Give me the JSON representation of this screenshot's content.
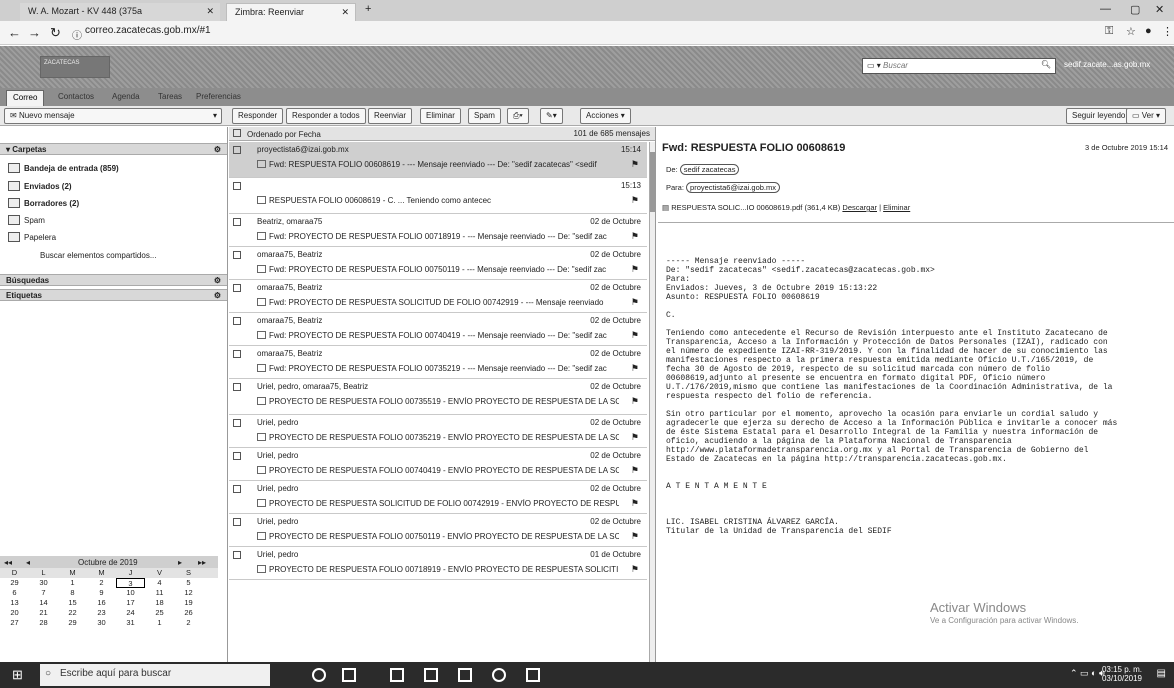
{
  "browser": {
    "tabs": [
      {
        "title": "W. A. Mozart - KV 448 (375a"
      },
      {
        "title": "Zimbra: Reenviar"
      }
    ],
    "url": "correo.zacatecas.gob.mx/#1"
  },
  "header": {
    "logo_text": "ZACATECAS",
    "search_placeholder": "Buscar",
    "user": "sedif.zacate...as.gob.mx"
  },
  "app_tabs": [
    "Correo",
    "Contactos",
    "Agenda",
    "Tareas",
    "Preferencias"
  ],
  "toolbar": {
    "new_message": "Nuevo mensaje",
    "reply": "Responder",
    "reply_all": "Responder a todos",
    "forward": "Reenviar",
    "delete": "Eliminar",
    "spam": "Spam",
    "actions": "Acciones",
    "keep_reading": "Seguir leyendo",
    "view": "Ver"
  },
  "sidebar": {
    "folders_title": "Carpetas",
    "folders": [
      {
        "label": "Bandeja de entrada (859)",
        "bold": true
      },
      {
        "label": "Enviados (2)",
        "bold": true
      },
      {
        "label": "Borradores (2)",
        "bold": true
      },
      {
        "label": "Spam",
        "bold": false
      },
      {
        "label": "Papelera",
        "bold": false
      }
    ],
    "shared": "Buscar elementos compartidos...",
    "searches_title": "Búsquedas",
    "tags_title": "Etiquetas"
  },
  "calendar": {
    "month": "Octubre de 2019",
    "weekdays": [
      "D",
      "L",
      "M",
      "M",
      "J",
      "V",
      "S"
    ],
    "weeks": [
      [
        "29",
        "30",
        "1",
        "2",
        "3",
        "4",
        "5"
      ],
      [
        "6",
        "7",
        "8",
        "9",
        "10",
        "11",
        "12"
      ],
      [
        "13",
        "14",
        "15",
        "16",
        "17",
        "18",
        "19"
      ],
      [
        "20",
        "21",
        "22",
        "23",
        "24",
        "25",
        "26"
      ],
      [
        "27",
        "28",
        "29",
        "30",
        "31",
        "1",
        "2"
      ]
    ]
  },
  "message_list": {
    "sort_label": "Ordenado por Fecha",
    "count": "101 de 685 mensajes",
    "messages": [
      {
        "from": "proyectista6@izai.gob.mx",
        "date": "15:14",
        "subject": "Fwd: RESPUESTA FOLIO 00608619 - --- Mensaje reenviado --- De: \"sedif zacatecas\" <sedif"
      },
      {
        "from": "",
        "date": "15:13",
        "subject": "RESPUESTA FOLIO 00608619 - C.  ... Teniendo como antecec"
      },
      {
        "from": "Beatriz, omaraa75",
        "date": "02 de Octubre",
        "subject": "Fwd: PROYECTO DE RESPUESTA FOLIO 00718919 - --- Mensaje reenviado --- De: \"sedif zac"
      },
      {
        "from": "omaraa75, Beatriz",
        "date": "02 de Octubre",
        "subject": "Fwd: PROYECTO DE RESPUESTA FOLIO 00750119 - --- Mensaje reenviado --- De: \"sedif zac"
      },
      {
        "from": "omaraa75, Beatriz",
        "date": "02 de Octubre",
        "subject": "Fwd: PROYECTO DE RESPUESTA SOLICITUD DE FOLIO 00742919 - --- Mensaje reenviado"
      },
      {
        "from": "omaraa75, Beatriz",
        "date": "02 de Octubre",
        "subject": "Fwd: PROYECTO DE RESPUESTA FOLIO 00740419 - --- Mensaje reenviado --- De: \"sedif zac"
      },
      {
        "from": "omaraa75, Beatriz",
        "date": "02 de Octubre",
        "subject": "Fwd: PROYECTO DE RESPUESTA FOLIO 00735219 - --- Mensaje reenviado --- De: \"sedif zac"
      },
      {
        "from": "Uriel, pedro, omaraa75, Beatriz",
        "date": "02 de Octubre",
        "subject": "PROYECTO DE RESPUESTA FOLIO 00735519 - ENVÍO PROYECTO DE RESPUESTA DE LA SC"
      },
      {
        "from": "Uriel, pedro",
        "date": "02 de Octubre",
        "subject": "PROYECTO DE RESPUESTA FOLIO 00735219 - ENVÍO PROYECTO DE RESPUESTA DE LA SC"
      },
      {
        "from": "Uriel, pedro",
        "date": "02 de Octubre",
        "subject": "PROYECTO DE RESPUESTA FOLIO 00740419 - ENVÍO PROYECTO DE RESPUESTA DE LA SC"
      },
      {
        "from": "Uriel, pedro",
        "date": "02 de Octubre",
        "subject": "PROYECTO DE RESPUESTA SOLICITUD DE FOLIO 00742919 - ENVÍO PROYECTO DE RESPU"
      },
      {
        "from": "Uriel, pedro",
        "date": "02 de Octubre",
        "subject": "PROYECTO DE RESPUESTA FOLIO 00750119 - ENVÍO PROYECTO DE RESPUESTA DE LA SC"
      },
      {
        "from": "Uriel, pedro",
        "date": "01 de Octubre",
        "subject": "PROYECTO DE RESPUESTA FOLIO 00718919 - ENVÍO PROYECTO DE RESPUESTA SOLICITI"
      }
    ]
  },
  "reader": {
    "title": "Fwd: RESPUESTA FOLIO 00608619",
    "date": "3 de Octubre 2019 15:14",
    "from_label": "De:",
    "from": "sedif zacatecas",
    "to_label": "Para:",
    "to": "proyectista6@izai.gob.mx",
    "attachment": "RESPUESTA SOLIC...IO 00608619.pdf (361,4 KB)",
    "download": "Descargar",
    "delete": "Eliminar",
    "body": "----- Mensaje reenviado -----\nDe: \"sedif zacatecas\" <sedif.zacatecas@zacatecas.gob.mx>\nPara:\nEnviados: Jueves, 3 de Octubre 2019 15:13:22\nAsunto: RESPUESTA FOLIO 00608619\n\nC.\n\nTeniendo como antecedente el Recurso de Revisión interpuesto ante el Instituto Zacatecano de\nTransparencia, Acceso a la Información y Protección de Datos Personales (IZAI), radicado con\nel número de expediente IZAI-RR-319/2019. Y con la finalidad de hacer de su conocimiento las\nmanifestaciones respecto a la primera respuesta emitida mediante Oficio U.T./165/2019, de\nfecha 30 de Agosto de 2019, respecto de su solicitud marcada con número de folio\n00608619,adjunto al presente se encuentra en formato digital PDF, Oficio número\nU.T./176/2019,mismo que contiene las manifestaciones de la Coordinación Administrativa, de la\nrespuesta respecto del folio de referencia.\n\nSin otro particular por el momento, aprovecho la ocasión para enviarle un cordial saludo y\nagradecerle que ejerza su derecho de Acceso a la Información Pública e invitarle a conocer más\nde éste Sistema Estatal para el Desarrollo Integral de la Familia y nuestra información de\noficio, acudiendo a la página de la Plataforma Nacional de Transparencia\nhttp://www.plataformadetransparencia.org.mx y al Portal de Transparencia de Gobierno del\nEstado de Zacatecas en la página http://transparencia.zacatecas.gob.mx.\n\n\nA T E N T A M E N T E\n\n\n\nLIC. ISABEL CRISTINA ÁLVAREZ GARCÍA.\nTitular de la Unidad de Transparencia del SEDIF"
  },
  "windows": {
    "activate_title": "Activar Windows",
    "activate_sub": "Ve a Configuración para activar Windows.",
    "search": "Escribe aquí para buscar",
    "time": "03:15 p. m.",
    "date": "03/10/2019"
  }
}
